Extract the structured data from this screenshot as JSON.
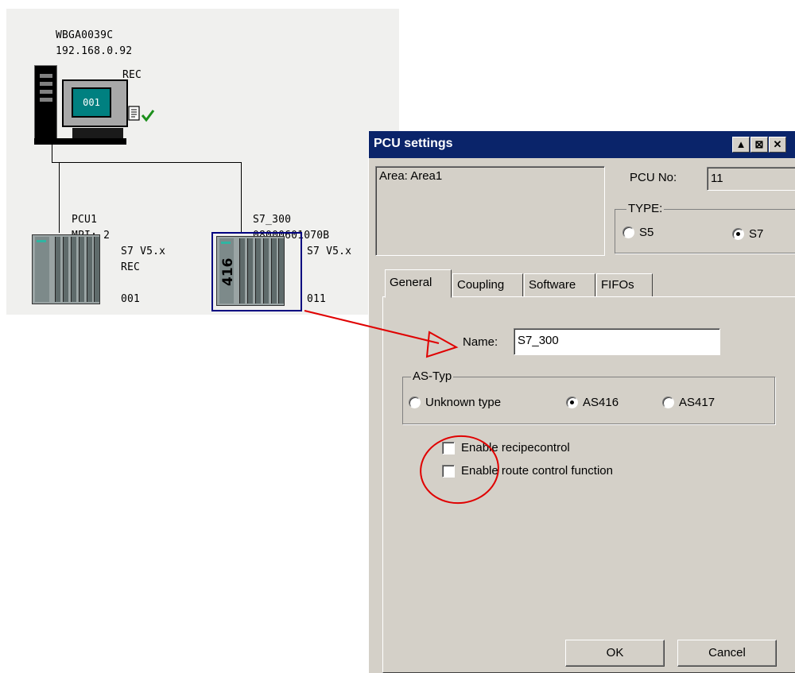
{
  "topology": {
    "station": {
      "name": "WBGA0039C",
      "ip": "192.168.0.92",
      "role": "REC",
      "screen_label": "001"
    },
    "pcu1": {
      "name": "PCU1",
      "address": "MPI: 2",
      "version": "S7 V5.x",
      "role": "REC",
      "number": "001"
    },
    "s7_300": {
      "name": "S7_300",
      "address": "08000601070B",
      "version": "S7 V5.x",
      "model_label": "416",
      "number": "011"
    }
  },
  "dialog": {
    "title": "PCU settings",
    "area_text": "Area: Area1",
    "pcu_no_label": "PCU No:",
    "pcu_no_value": "11",
    "type_legend": "TYPE:",
    "type_options": [
      "S5",
      "S7"
    ],
    "type_selected": "S7",
    "tabs": [
      "General",
      "Coupling",
      "Software",
      "FIFOs"
    ],
    "active_tab": "General",
    "name_label": "Name:",
    "name_value": "S7_300",
    "as_typ_legend": "AS-Typ",
    "as_typ_options": [
      "Unknown type",
      "AS416",
      "AS417"
    ],
    "as_typ_selected": "AS416",
    "checkboxes": [
      {
        "label": "Enable recipecontrol",
        "checked": false
      },
      {
        "label": "Enable route control function",
        "checked": false
      }
    ],
    "ok_label": "OK",
    "cancel_label": "Cancel",
    "title_buttons": [
      "▲",
      "⊠",
      "✕"
    ]
  },
  "colors": {
    "titlebar": "#0a246a",
    "annotation": "#e00000",
    "dialog_face": "#d4d0c8",
    "panel_bg": "#f0f0ee",
    "selection": "#000080"
  }
}
